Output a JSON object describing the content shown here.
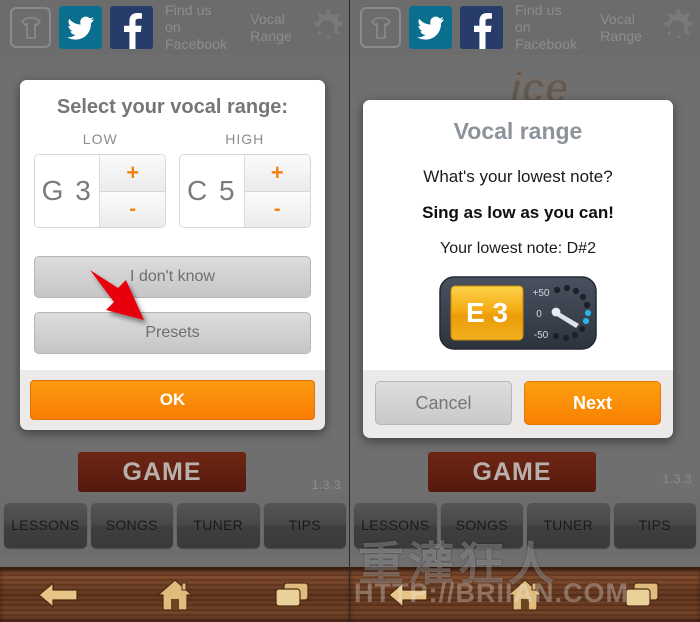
{
  "header": {
    "tshirt_icon": "tshirt-icon",
    "twitter_icon": "twitter-icon",
    "facebook_icon": "facebook-icon",
    "facebook_label": "Find us on\nFacebook",
    "vocal_range_label": "Vocal\nRange",
    "gear_icon": "gear-icon",
    "colors": {
      "twitter_blue": "#0a6e8f",
      "facebook_blue": "#283c69",
      "bar_gray": "#6c6c6c"
    }
  },
  "background": {
    "game_label": "GAME",
    "version": "1.3.3",
    "mic_icon": "microphone-icon"
  },
  "tabs": [
    {
      "label": "LESSONS"
    },
    {
      "label": "SONGS"
    },
    {
      "label": "TUNER"
    },
    {
      "label": "TIPS"
    }
  ],
  "navbar": {
    "back_icon": "back-arrow-icon",
    "home_icon": "home-icon",
    "recents_icon": "recent-apps-icon"
  },
  "watermark": {
    "cjk": "重灌狂人",
    "url": "HTTP://BRIIAN.COM"
  },
  "left_dialog": {
    "title": "Select your vocal range:",
    "low": {
      "caption": "LOW",
      "note": "G 3",
      "plus": "+",
      "minus": "-"
    },
    "high": {
      "caption": "HIGH",
      "note": "C 5",
      "plus": "+",
      "minus": "-"
    },
    "dont_know_label": "I don't know",
    "presets_label": "Presets",
    "ok_label": "OK",
    "accent_color": "#f97c04"
  },
  "annotation": {
    "arrow": "red-arrow-icon",
    "color": "#e8000d"
  },
  "right_dialog": {
    "title": "Vocal range",
    "question": "What's your lowest note?",
    "instruction": "Sing as low as you can!",
    "detected": "Your lowest note: D#2",
    "tuner": {
      "note": "E 3",
      "scale_top": "+50",
      "scale_mid": "0",
      "scale_bottom": "-50",
      "display_color": "#f0a81c",
      "body_color": "#3a414d",
      "led_color": "#28b6e8"
    },
    "cancel_label": "Cancel",
    "next_label": "Next"
  }
}
